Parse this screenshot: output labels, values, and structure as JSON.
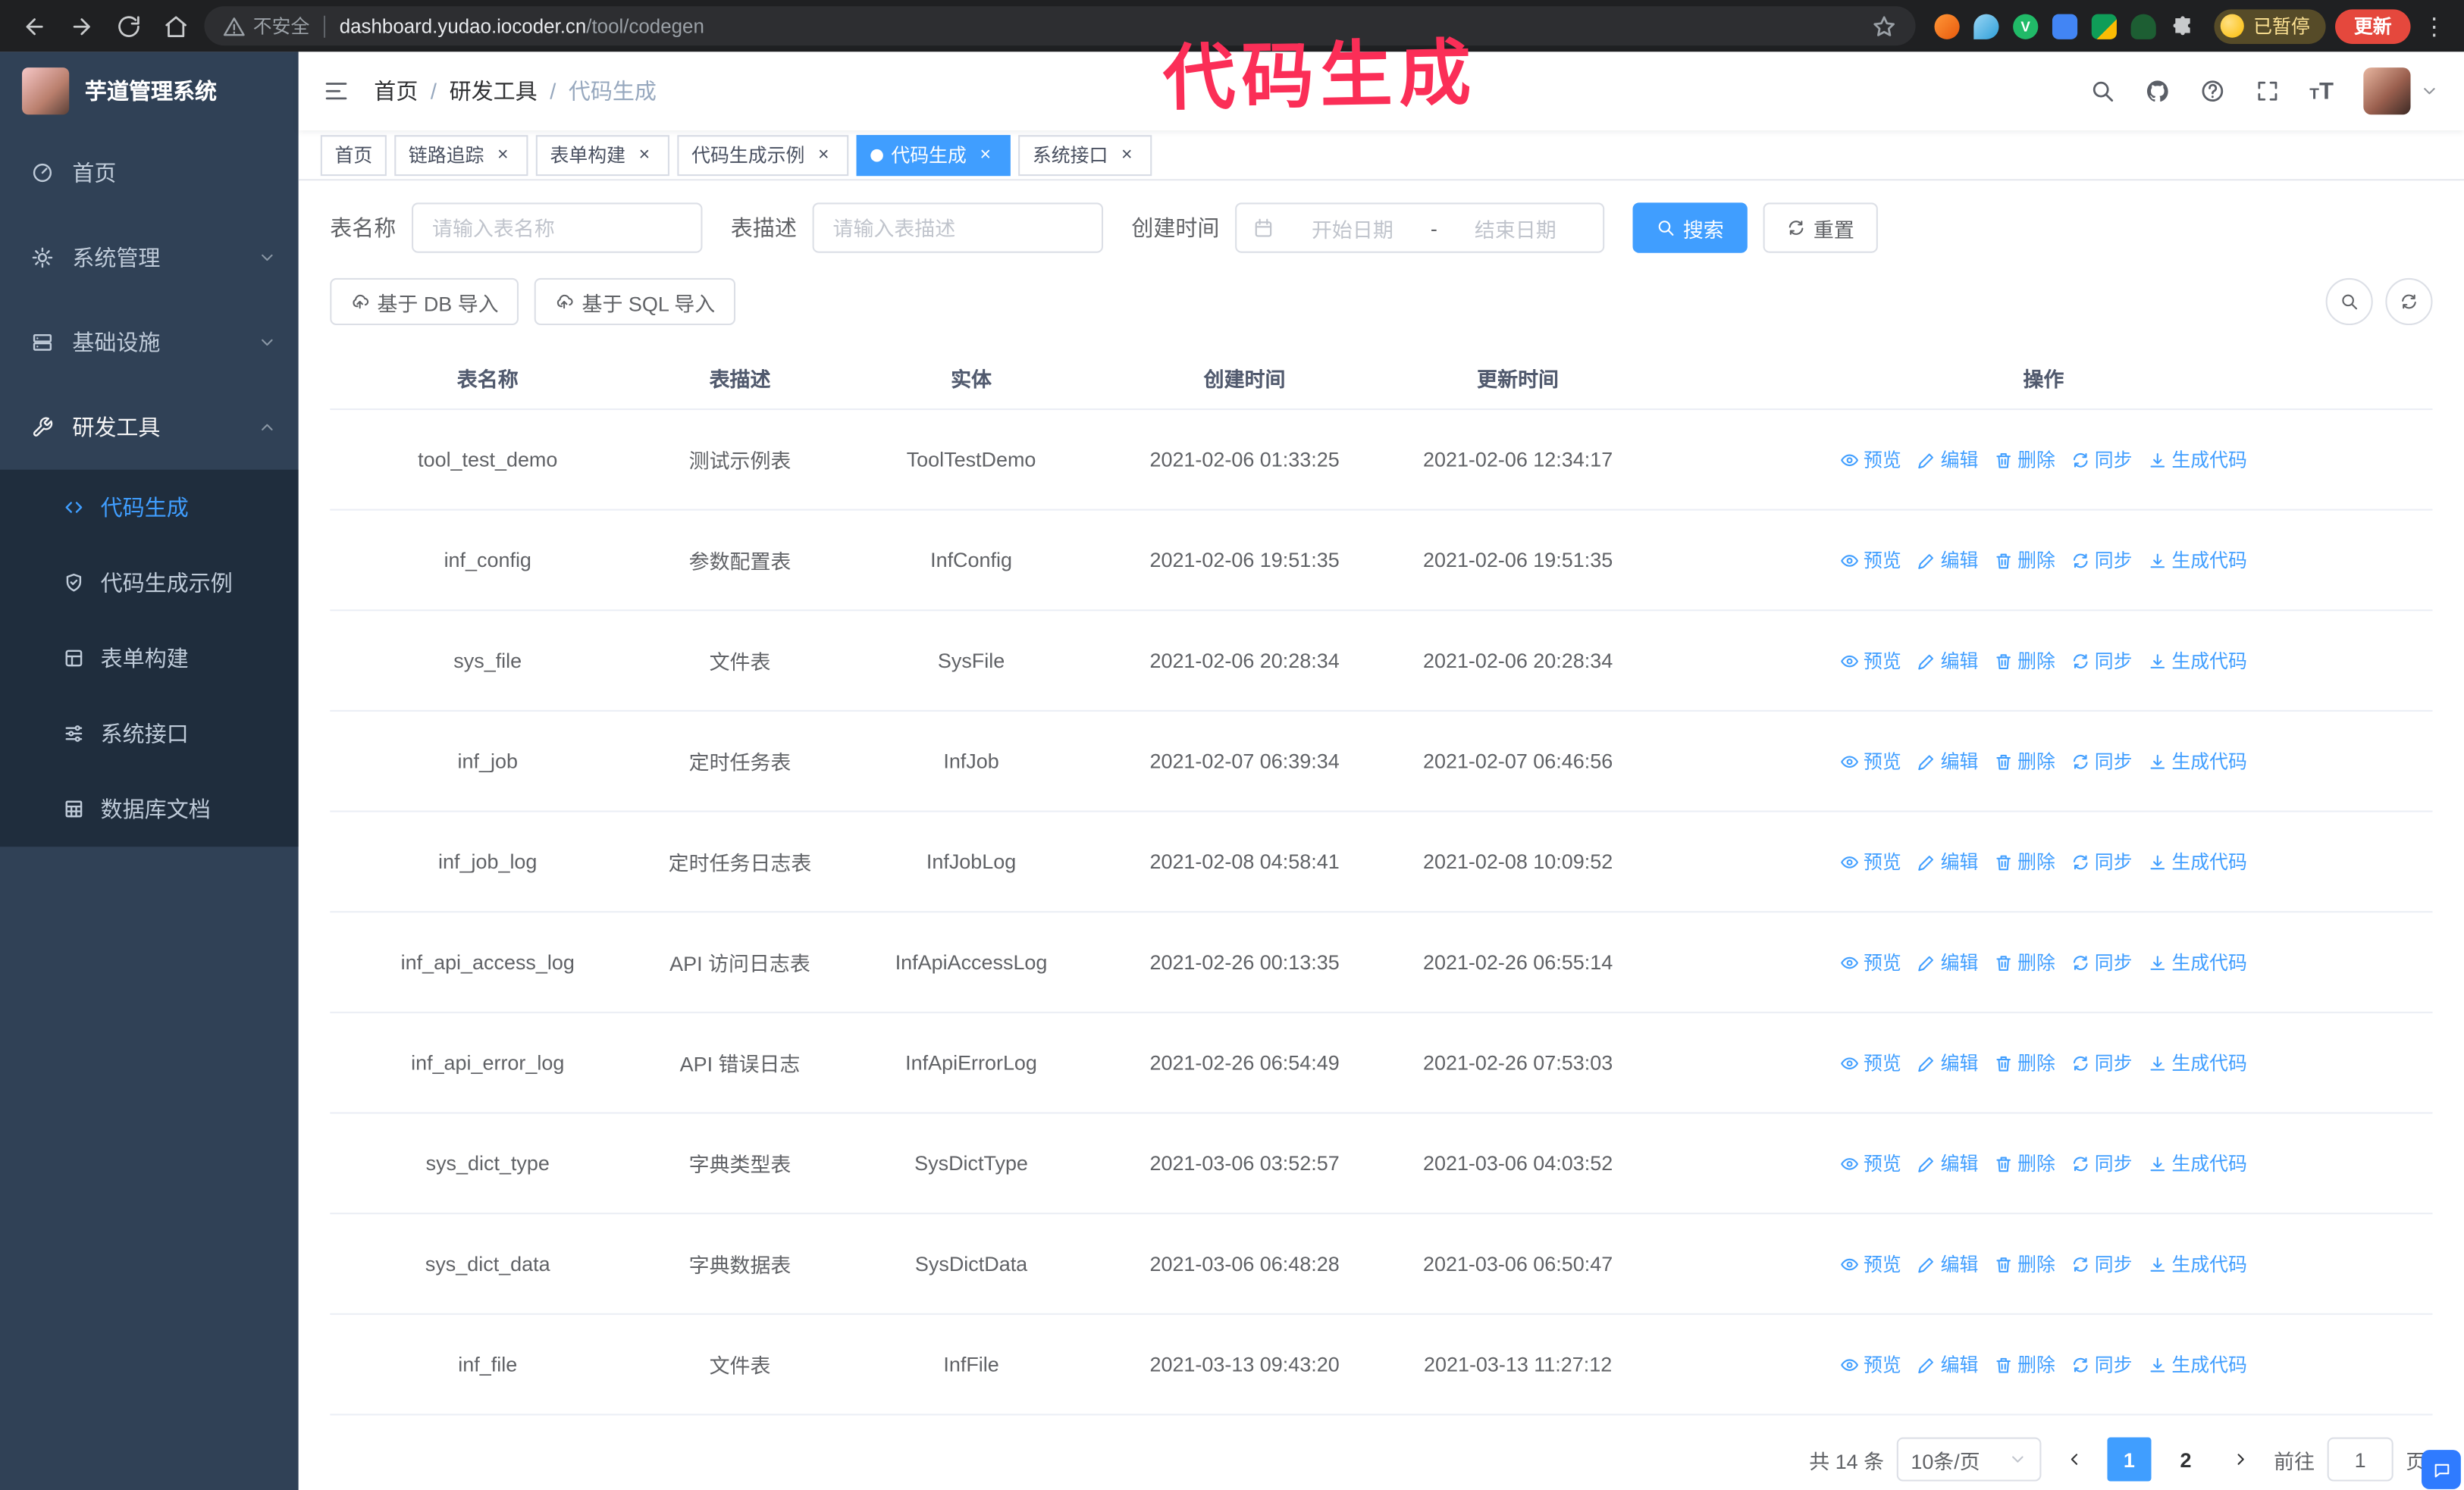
{
  "browser": {
    "security_label": "不安全",
    "url_domain": "dashboard.yudao.iocoder.cn",
    "url_path": "/tool/codegen",
    "profile_badge": "已暂停",
    "update_button": "更新"
  },
  "annotation": {
    "text": "代码生成",
    "color": "#fb2e57"
  },
  "icons": {
    "close": "×",
    "kebab": "⋮",
    "font_size": "T"
  },
  "sidebar": {
    "logo_title": "芋道管理系统",
    "items": [
      {
        "label": "首页"
      },
      {
        "label": "系统管理"
      },
      {
        "label": "基础设施"
      },
      {
        "label": "研发工具"
      }
    ],
    "submenu": [
      {
        "label": "代码生成",
        "active": true
      },
      {
        "label": "代码生成示例"
      },
      {
        "label": "表单构建"
      },
      {
        "label": "系统接口"
      },
      {
        "label": "数据库文档"
      }
    ]
  },
  "navbar": {
    "breadcrumb": [
      "首页",
      "研发工具",
      "代码生成"
    ],
    "separator": "/"
  },
  "tags": [
    {
      "label": "首页",
      "closable": false,
      "active": false
    },
    {
      "label": "链路追踪",
      "closable": true,
      "active": false
    },
    {
      "label": "表单构建",
      "closable": true,
      "active": false
    },
    {
      "label": "代码生成示例",
      "closable": true,
      "active": false
    },
    {
      "label": "代码生成",
      "closable": true,
      "active": true
    },
    {
      "label": "系统接口",
      "closable": true,
      "active": false
    }
  ],
  "search_form": {
    "table_name_label": "表名称",
    "table_name_placeholder": "请输入表名称",
    "table_desc_label": "表描述",
    "table_desc_placeholder": "请输入表描述",
    "create_time_label": "创建时间",
    "date_start_placeholder": "开始日期",
    "date_separator": "-",
    "date_end_placeholder": "结束日期",
    "search_button": "搜索",
    "reset_button": "重置"
  },
  "toolbar": {
    "import_db_button": "基于 DB 导入",
    "import_sql_button": "基于 SQL 导入"
  },
  "table": {
    "headers": [
      "表名称",
      "表描述",
      "实体",
      "创建时间",
      "更新时间",
      "操作"
    ],
    "actions": [
      "预览",
      "编辑",
      "删除",
      "同步",
      "生成代码"
    ],
    "rows": [
      {
        "name": "tool_test_demo",
        "desc": "测试示例表",
        "entity": "ToolTestDemo",
        "created": "2021-02-06 01:33:25",
        "updated": "2021-02-06 12:34:17"
      },
      {
        "name": "inf_config",
        "desc": "参数配置表",
        "entity": "InfConfig",
        "created": "2021-02-06 19:51:35",
        "updated": "2021-02-06 19:51:35"
      },
      {
        "name": "sys_file",
        "desc": "文件表",
        "entity": "SysFile",
        "created": "2021-02-06 20:28:34",
        "updated": "2021-02-06 20:28:34"
      },
      {
        "name": "inf_job",
        "desc": "定时任务表",
        "entity": "InfJob",
        "created": "2021-02-07 06:39:34",
        "updated": "2021-02-07 06:46:56"
      },
      {
        "name": "inf_job_log",
        "desc": "定时任务日志表",
        "entity": "InfJobLog",
        "created": "2021-02-08 04:58:41",
        "updated": "2021-02-08 10:09:52"
      },
      {
        "name": "inf_api_access_log",
        "desc": "API 访问日志表",
        "entity": "InfApiAccessLog",
        "created": "2021-02-26 00:13:35",
        "updated": "2021-02-26 06:55:14"
      },
      {
        "name": "inf_api_error_log",
        "desc": "API 错误日志",
        "entity": "InfApiErrorLog",
        "created": "2021-02-26 06:54:49",
        "updated": "2021-02-26 07:53:03"
      },
      {
        "name": "sys_dict_type",
        "desc": "字典类型表",
        "entity": "SysDictType",
        "created": "2021-03-06 03:52:57",
        "updated": "2021-03-06 04:03:52"
      },
      {
        "name": "sys_dict_data",
        "desc": "字典数据表",
        "entity": "SysDictData",
        "created": "2021-03-06 06:48:28",
        "updated": "2021-03-06 06:50:47"
      },
      {
        "name": "inf_file",
        "desc": "文件表",
        "entity": "InfFile",
        "created": "2021-03-13 09:43:20",
        "updated": "2021-03-13 11:27:12"
      }
    ]
  },
  "pagination": {
    "total": "共 14 条",
    "page_size": "10条/页",
    "pages": [
      "1",
      "2"
    ],
    "current": "1",
    "goto_label": "前往",
    "goto_value": "1",
    "goto_suffix": "页"
  },
  "colors": {
    "accent": "#409eff",
    "sidebar_bg": "#304156",
    "submenu_bg": "#1f2d3d",
    "chrome_bg": "#1f2022",
    "update_button": "#e5483d",
    "annotation": "#fb2e57"
  }
}
